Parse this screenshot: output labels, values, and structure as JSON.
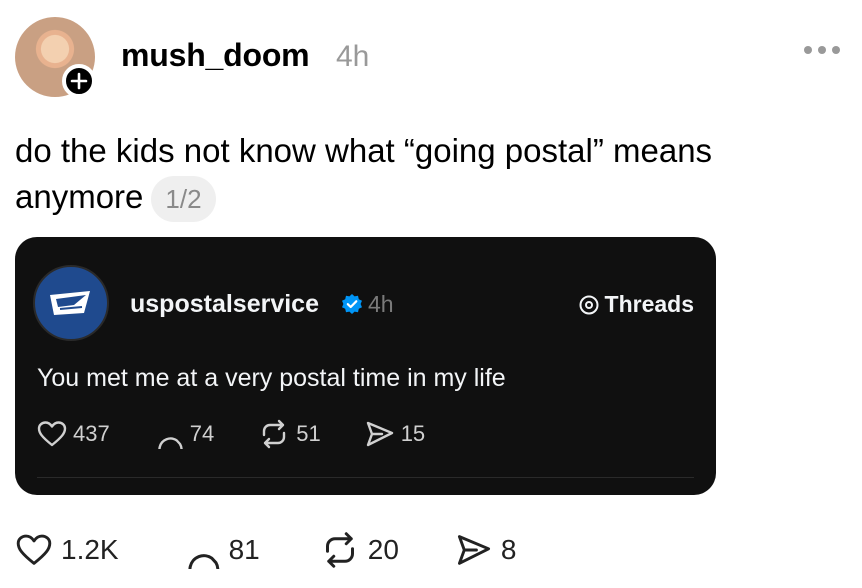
{
  "post": {
    "username": "mush_doom",
    "time": "4h",
    "text": "do the kids not know what “going postal” means anymore",
    "page_indicator": "1/2",
    "actions": {
      "likes": "1.2K",
      "replies": "81",
      "reposts": "20",
      "shares": "8"
    }
  },
  "quoted": {
    "username": "uspostalservice",
    "time": "4h",
    "source_label": "Threads",
    "text": "You met me at a very postal time in my life",
    "actions": {
      "likes": "437",
      "replies": "74",
      "reposts": "51",
      "shares": "15"
    }
  },
  "colors": {
    "card_bg": "#101010",
    "verified": "#0095f6",
    "usps_blue": "#1f4a8e",
    "muted": "#999999"
  },
  "icons": [
    "plus-icon",
    "more-icon",
    "heart-icon",
    "reply-icon",
    "repost-icon",
    "share-icon",
    "verified-icon",
    "threads-icon",
    "usps-eagle-icon"
  ]
}
